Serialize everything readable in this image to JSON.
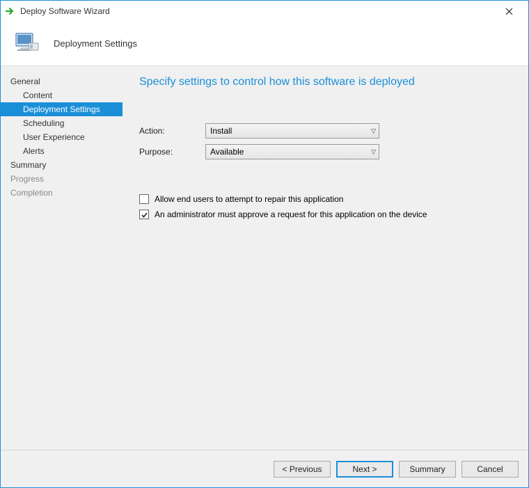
{
  "window": {
    "title": "Deploy Software Wizard"
  },
  "header": {
    "heading": "Deployment Settings"
  },
  "sidebar": {
    "items": [
      {
        "label": "General",
        "sub": false,
        "selected": false,
        "disabled": false
      },
      {
        "label": "Content",
        "sub": true,
        "selected": false,
        "disabled": false
      },
      {
        "label": "Deployment Settings",
        "sub": true,
        "selected": true,
        "disabled": false
      },
      {
        "label": "Scheduling",
        "sub": true,
        "selected": false,
        "disabled": false
      },
      {
        "label": "User Experience",
        "sub": true,
        "selected": false,
        "disabled": false
      },
      {
        "label": "Alerts",
        "sub": true,
        "selected": false,
        "disabled": false
      },
      {
        "label": "Summary",
        "sub": false,
        "selected": false,
        "disabled": false
      },
      {
        "label": "Progress",
        "sub": false,
        "selected": false,
        "disabled": true
      },
      {
        "label": "Completion",
        "sub": false,
        "selected": false,
        "disabled": true
      }
    ]
  },
  "content": {
    "heading": "Specify settings to control how this software is deployed",
    "action_label": "Action:",
    "action_value": "Install",
    "purpose_label": "Purpose:",
    "purpose_value": "Available",
    "checkbox1_label": "Allow end users to attempt to repair this application",
    "checkbox1_checked": false,
    "checkbox2_label": "An administrator must approve a request for this application on the device",
    "checkbox2_checked": true
  },
  "footer": {
    "previous": "< Previous",
    "next": "Next >",
    "summary": "Summary",
    "cancel": "Cancel"
  }
}
